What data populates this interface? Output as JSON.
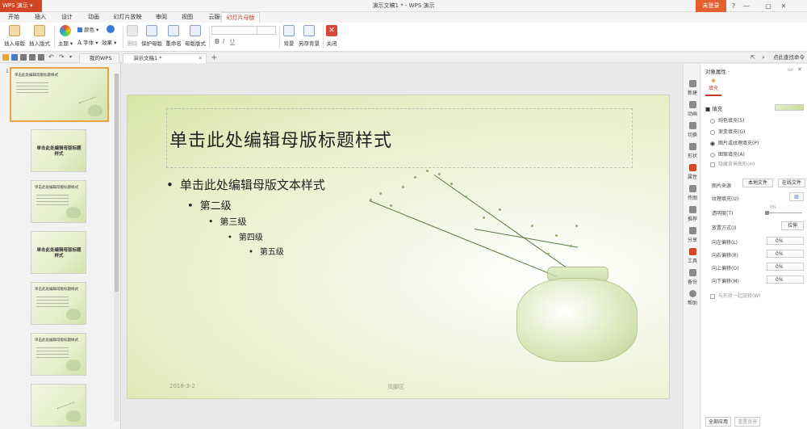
{
  "app": {
    "menu_label": "WPS 演示",
    "doc_title": "演示文稿1 * - WPS 演示",
    "login_label": "未登录",
    "win_controls": [
      "?",
      "—",
      "□",
      "✕"
    ]
  },
  "tabs": [
    "开始",
    "插入",
    "设计",
    "动画",
    "幻灯片放映",
    "审阅",
    "视图",
    "云服务",
    "幻灯片母版"
  ],
  "active_tab": "幻灯片母版",
  "ribbon": {
    "insert_master": "插入母版",
    "insert_layout": "插入版式",
    "theme": "主题",
    "colors": "颜色",
    "fonts": "字体",
    "effects": "效果",
    "delete": "删除",
    "protect_master": "保护母版",
    "rename": "重命名",
    "master_layout": "母版版式",
    "background": "背景",
    "save_background": "另存背景",
    "close": "关闭",
    "bold": "B",
    "italic": "I",
    "underline": "U"
  },
  "doc_tabs": {
    "my_wps": "我的WPS",
    "current": "演示文稿1 *",
    "find_command": "点此查找命令"
  },
  "thumbnails": {
    "number": "1",
    "master_title": "单击此处编辑母版标题样式",
    "layout_title": "单击此处编辑母版标题样式",
    "content_title": "单击此处编辑母版标题样式"
  },
  "slide": {
    "title": "单击此处编辑母版标题样式",
    "levels": [
      "单击此处编辑母版文本样式",
      "第二级",
      "第三级",
      "第四级",
      "第五级"
    ],
    "date": "2018-3-2",
    "footer": "页脚区"
  },
  "side_tools": [
    "新建",
    "动画",
    "切换",
    "形状",
    "属性",
    "传图",
    "推荐",
    "分享",
    "工具",
    "备份",
    "帮助"
  ],
  "props": {
    "title": "对象属性 ·",
    "tab": "填充",
    "section_fill": "■ 填充",
    "fill_options": [
      "纯色填充(S)",
      "渐变填充(G)",
      "图片或纹理填充(P)",
      "图案填充(A)"
    ],
    "fill_selected": 2,
    "hide_bg": "隐藏背景图形(H)",
    "pic_source": "图片来源",
    "local_file": "本地文件",
    "online_file": "在线文件",
    "texture_fill": "纹理填充(U)",
    "transparency": "透明度(T)",
    "transparency_value": "0%",
    "transparency_percent": 0,
    "placement": "放置方式(I)",
    "placement_value": "拉伸",
    "offsets": [
      {
        "label": "向左偏移(L)",
        "value": "0%"
      },
      {
        "label": "向右偏移(R)",
        "value": "0%"
      },
      {
        "label": "向上偏移(O)",
        "value": "0%"
      },
      {
        "label": "向下偏移(M)",
        "value": "0%"
      }
    ],
    "rotate_with_shape": "与形状一起旋转(W)",
    "apply_all": "全部应用",
    "reset_bg": "重置背景"
  },
  "colors": {
    "accent": "#d24625",
    "login": "#e2612e",
    "thumb_selected": "#e8a24a"
  }
}
